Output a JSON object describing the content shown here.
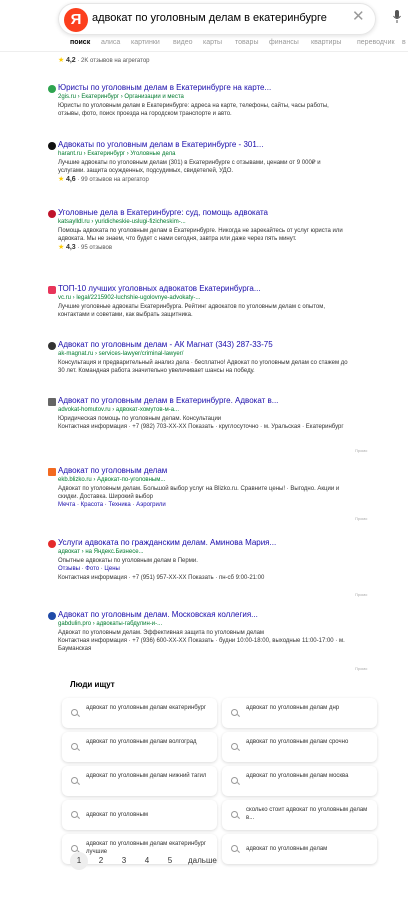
{
  "search": {
    "query": "адвокат по уголовным делам в екатеринбурге",
    "logo": "Я"
  },
  "tabs": [
    "поиск",
    "алиса",
    "картинки",
    "видео",
    "карты",
    "товары",
    "финансы",
    "квартиры",
    "переводчик",
    "в"
  ],
  "top_rating": {
    "score": "4,2",
    "text": "· 2K отзывов на агрегатор"
  },
  "results": [
    {
      "title": "Юристы по уголовным делам в Екатеринбурге на карте...",
      "url": "2gis.ru › Екатеринбург › Организации и места",
      "snippet": "Юристы по уголовным делам в Екатеринбурге: адреса на карте, телефоны, сайты, часы работы, отзывы, фото, поиск проезда на городском транспорте и авто."
    },
    {
      "title": "Адвокаты по уголовным делам в Екатеринбурге - 301...",
      "url": "harant.ru › Екатеринбург › Уголовные дела",
      "snippet": "Лучшие адвокаты по уголовным делам (301) в Екатеринбурге с отзывами, ценами от 9 000₽ и услугами. защита осужденных, подсудимых, свидетелей, УДО.",
      "rating": "4,6",
      "rating_text": "· 99 отзывов на агрегатор"
    },
    {
      "title": "Уголовные дела в Екатеринбурге: суд, помощь адвоката",
      "url": "katsaylldl.ru › yuridicheskie-uslugi-fizicheskim-...",
      "snippet": "Помощь адвоката по уголовным делам в Екатеринбурге. Никогда не зарекайтесь от услуг юриста или адвоката. Мы не знаем, что будет с нами сегодня, завтра или даже через пять минут.",
      "rating": "4,3",
      "rating_text": "· 95 отзывов"
    },
    {
      "title": "ТОП-10 лучших уголовных адвокатов Екатеринбурга...",
      "url": "vc.ru › legal/2215902-luchshie-ugolovnye-advokaty-...",
      "snippet": "Лучшие уголовные адвокаты Екатеринбурга. Рейтинг адвокатов по уголовным делам с опытом, контактами и советами, как выбрать защитника."
    },
    {
      "title": "Адвокат по уголовным делам - АК Магнат (343) 287-33-75",
      "url": "ak-magnat.ru › services-lawyer/criminal-lawyer/",
      "snippet": "Консультация и предварительный анализ дела · бесплатно! Адвокат по уголовным делам со стажем до 30 лет. Командная работа значительно увеличивает шансы на победу."
    },
    {
      "title": "Адвокат по уголовным делам в Екатеринбурге. Адвокат в...",
      "url": "advokat-homutov.ru › адвокат-хомутов-м-а...",
      "snippet": "Юридическая помощь по уголовным делам. Консультации",
      "contact": "Контактная информация · +7 (982) 703-XX-XX Показать · круглосуточно · м. Уральская · Екатеринбург",
      "ad": "Промо"
    },
    {
      "title": "Адвокат по уголовным делам",
      "url": "ekb.blizko.ru › Адвокат-по-уголовным...",
      "snippet": "Адвокат по уголовным делам. Большой выбор услуг на Blizko.ru. Сравните цены! · Выгодно. Акции и скидки. Доставка. Широкий выбор",
      "links": "Мечта · Красота · Техника · Аэрогрили",
      "ad": "Промо"
    },
    {
      "title": "Услуги адвоката по гражданским делам. Аминова Мария...",
      "url": "адвокат › на Яндекс.Бизнесе...",
      "snippet": "Опытные адвокаты по уголовным делам в Перми.",
      "links": "Отзывы · Фото · Цены",
      "contact": "Контактная информация · +7 (951) 957-XX-XX Показать · пн-сб 9:00-21:00",
      "ad": "Промо"
    },
    {
      "title": "Адвокат по уголовным делам. Московская коллегия...",
      "url": "gabdulin.pro › адвокаты-габдулин-и-...",
      "snippet": "Адвокат по уголовным делам. Эффективная защита по уголовным делам",
      "contact": "Контактная информация · +7 (936) 600-XX-XX Показать · будни 10:00-18:00, выходные 11:00-17:00 · м. Бауманская",
      "ad": "Промо"
    }
  ],
  "people": {
    "heading": "Люди ищут",
    "items": [
      "адвокат по уголовным делам екатеринбург",
      "адвокат по уголовным делам днр",
      "адвокат по уголовным делам волгоград",
      "адвокат по уголовным делам срочно",
      "адвокат по уголовным делам нижний тагил",
      "адвокат по уголовным делам москва",
      "адвокат по уголовным",
      "сколько стоит адвокат по уголовным делам в...",
      "адвокат по уголовным делам екатеринбург лучшие",
      "адвокат по уголовным делам"
    ]
  },
  "pager": {
    "pages": [
      "1",
      "2",
      "3",
      "4",
      "5"
    ],
    "next": "дальше"
  },
  "colors": {
    "link": "#1a0dab",
    "url": "#007a2f",
    "brand": "#fc3f1d"
  }
}
